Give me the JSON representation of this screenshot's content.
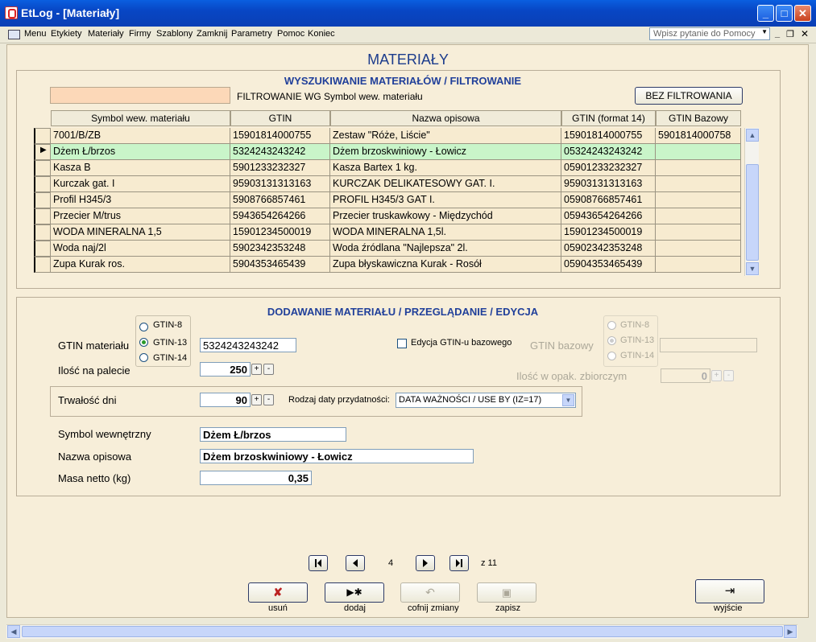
{
  "window": {
    "title": "EtLog - [Materiały]"
  },
  "menu": {
    "items": [
      "Menu",
      "Etykiety",
      "Materiały",
      "Firmy",
      "Szablony",
      "Zamknij",
      "Parametry",
      "Pomoc",
      "Koniec"
    ],
    "help_placeholder": "Wpisz pytanie do Pomocy"
  },
  "form": {
    "title": "MATERIAŁY",
    "search": {
      "title": "WYSZUKIWANIE MATERIAŁÓW / FILTROWANIE",
      "filter_value": "",
      "filter_label": "FILTROWANIE WG Symbol wew. materiału",
      "no_filter_button": "BEZ FILTROWANIA"
    },
    "grid": {
      "columns": [
        "Symbol wew. materiału",
        "GTIN",
        "Nazwa opisowa",
        "GTIN (format 14)",
        "GTIN Bazowy"
      ],
      "rows": [
        [
          "7001/B/ZB",
          "15901814000755",
          "Zestaw \"Róże, Liście\"",
          "15901814000755",
          "5901814000758"
        ],
        [
          "Dżem Ł/brzos",
          "5324243243242",
          "Dżem brzoskwiniowy - Łowicz",
          "05324243243242",
          ""
        ],
        [
          "Kasza B",
          "5901233232327",
          "Kasza Bartex 1 kg.",
          "05901233232327",
          ""
        ],
        [
          "Kurczak gat. I",
          "95903131313163",
          "KURCZAK DELIKATESOWY GAT. I.",
          "95903131313163",
          ""
        ],
        [
          "Profil H345/3",
          "5908766857461",
          "PROFIL H345/3 GAT I.",
          "05908766857461",
          ""
        ],
        [
          "Przecier M/trus",
          "5943654264266",
          "Przecier truskawkowy - Międzychód",
          "05943654264266",
          ""
        ],
        [
          "WODA MINERALNA 1,5",
          "15901234500019",
          "WODA MINERALNA 1,5l.",
          "15901234500019",
          ""
        ],
        [
          "Woda naj/2l",
          "5902342353248",
          "Woda źródlana \"Najlepsza\" 2l.",
          "05902342353248",
          ""
        ],
        [
          "Zupa Kurak ros.",
          "5904353465439",
          "Zupa błyskawiczna Kurak - Rosół",
          "05904353465439",
          ""
        ]
      ],
      "current_row": 1
    },
    "edit": {
      "title": "DODAWANIE MATERIAŁU / PRZEGLĄDANIE / EDYCJA",
      "gtin_label": "GTIN materiału",
      "gtin_options": [
        "GTIN-8",
        "GTIN-13",
        "GTIN-14"
      ],
      "gtin_selected": "GTIN-13",
      "gtin_value": "5324243243242",
      "base_edit_label": "Edycja GTIN-u bazowego",
      "base_gtin_label": "GTIN bazowy",
      "base_gtin_options": [
        "GTIN-8",
        "GTIN-13",
        "GTIN-14"
      ],
      "base_gtin_value": "",
      "pallet_label": "Ilość na palecie",
      "pallet_value": "250",
      "pack_label": "Ilość w opak. zbiorczym",
      "pack_value": "0",
      "shelf_label": "Trwałość dni",
      "shelf_value": "90",
      "date_type_label": "Rodzaj daty przydatności:",
      "date_type_value": "DATA WAŻNOŚCI / USE BY (IZ=17)",
      "symbol_label": "Symbol wewnętrzny",
      "symbol_value": "Dżem Ł/brzos",
      "name_label": "Nazwa opisowa",
      "name_value": "Dżem brzoskwiniowy - Łowicz",
      "mass_label": "Masa netto (kg)",
      "mass_value": "0,35"
    },
    "nav": {
      "current": "4",
      "total_text": "z 11"
    },
    "actions": {
      "delete": "usuń",
      "add": "dodaj",
      "undo": "cofnij zmiany",
      "save": "zapisz",
      "exit": "wyjście"
    }
  },
  "colors": {
    "title_bar": "#0846c4",
    "form_bg": "#f7eed9",
    "current_row": "#c9f5c9",
    "heading": "#21409a"
  }
}
